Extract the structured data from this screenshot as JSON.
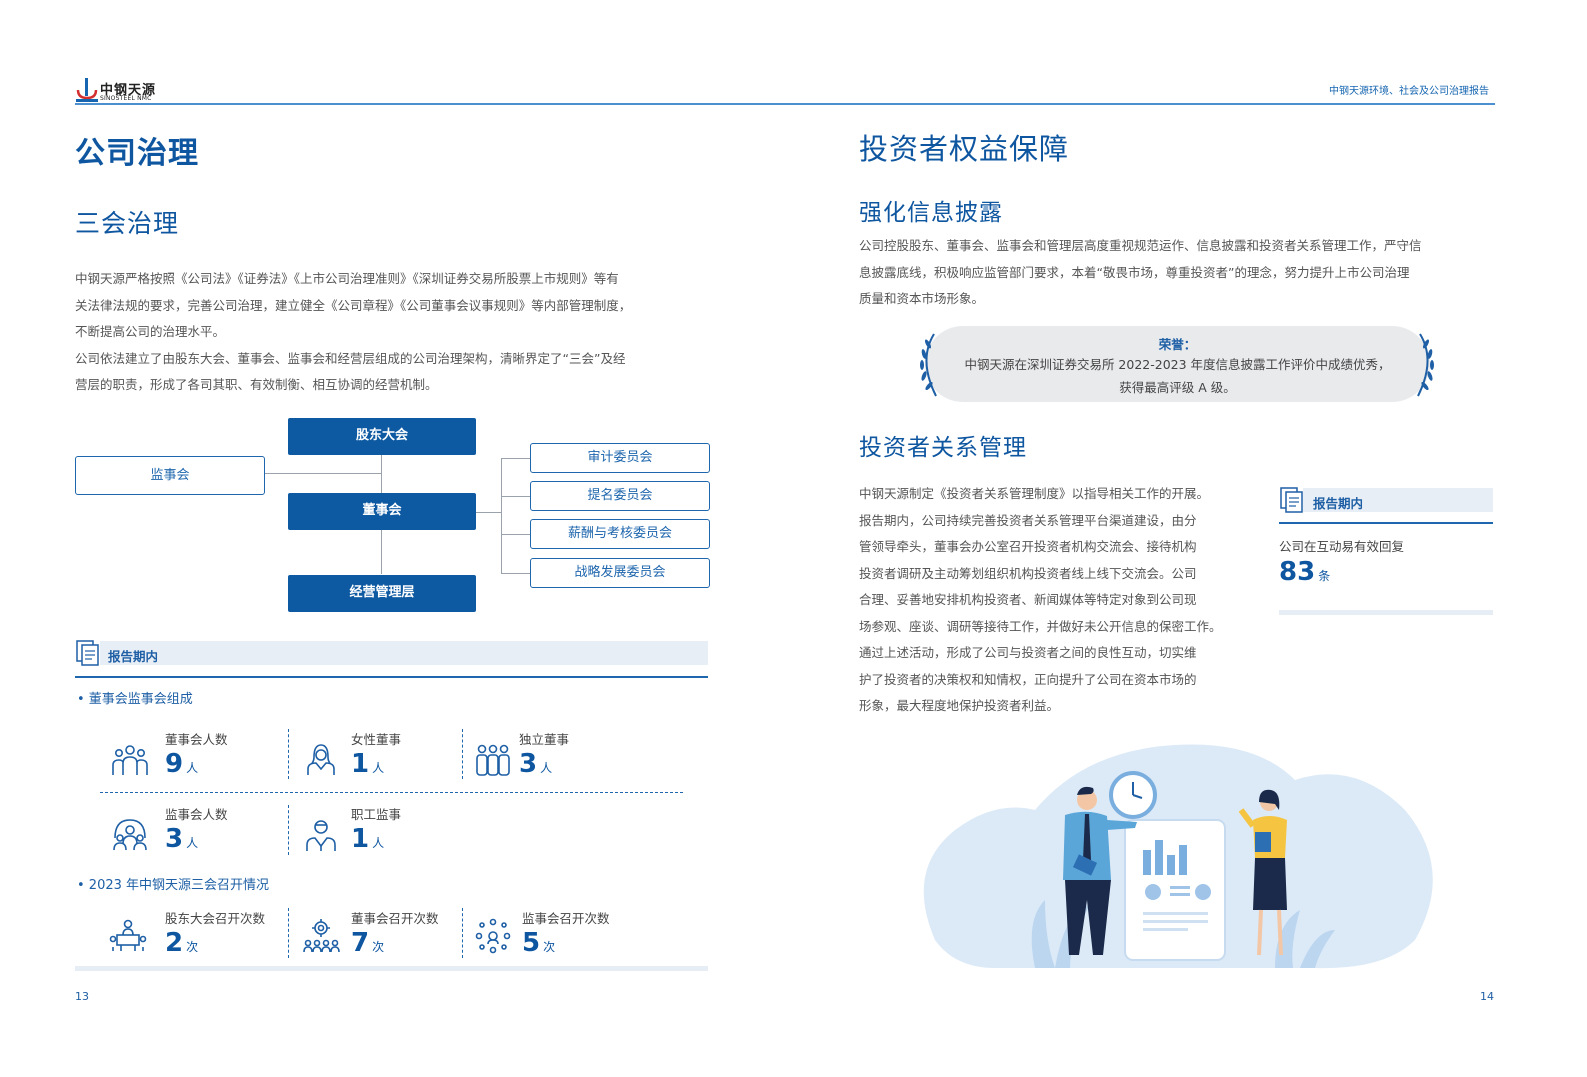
{
  "header": {
    "logo_cn": "中钢天源",
    "logo_en": "SINOSTEEL NMC",
    "report_title": "中钢天源环境、社会及公司治理报告"
  },
  "left": {
    "title": "公司治理",
    "section_title": "三会治理",
    "paragraph_lines": [
      "中钢天源严格按照《公司法》《证券法》《上市公司治理准则》《深圳证券交易所股票上市规则》等有",
      "关法律法规的要求，完善公司治理，建立健全《公司章程》《公司董事会议事规则》等内部管理制度，",
      "不断提高公司的治理水平。",
      "公司依法建立了由股东大会、董事会、监事会和经营层组成的公司治理架构，清晰界定了“三会”及经",
      "营层的职责，形成了各司其职、有效制衡、相互协调的经营机制。"
    ],
    "org_chart": {
      "shareholders": "股东大会",
      "supervisors": "监事会",
      "board": "董事会",
      "management": "经营管理层",
      "committees": [
        "审计委员会",
        "提名委员会",
        "薪酬与考核委员会",
        "战略发展委员会"
      ]
    },
    "info_header": "报告期内",
    "composition_title": "• 董事会监事会组成",
    "composition_stats": [
      {
        "label": "董事会人数",
        "value": "9",
        "unit": "人",
        "icon": "group-people-icon"
      },
      {
        "label": "女性董事",
        "value": "1",
        "unit": "人",
        "icon": "female-person-icon"
      },
      {
        "label": "独立董事",
        "value": "3",
        "unit": "人",
        "icon": "three-people-icon"
      },
      {
        "label": "监事会人数",
        "value": "3",
        "unit": "人",
        "icon": "team-circle-icon"
      },
      {
        "label": "职工监事",
        "value": "1",
        "unit": "人",
        "icon": "worker-person-icon"
      }
    ],
    "meetings_title": "• 2023 年中钢天源三会召开情况",
    "meeting_stats": [
      {
        "label": "股东大会召开次数",
        "value": "2",
        "unit": "次",
        "icon": "meeting-table-icon"
      },
      {
        "label": "董事会召开次数",
        "value": "7",
        "unit": "次",
        "icon": "board-gear-icon"
      },
      {
        "label": "监事会召开次数",
        "value": "5",
        "unit": "次",
        "icon": "supervisor-network-icon"
      }
    ],
    "page_number": "13"
  },
  "right": {
    "title": "投资者权益保障",
    "disclosure_title": "强化信息披露",
    "disclosure_lines": [
      "公司控股股东、董事会、监事会和管理层高度重视规范运作、信息披露和投资者关系管理工作，严守信",
      "息披露底线，积极响应监管部门要求，本着“敬畏市场，尊重投资者”的理念，努力提升上市公司治理",
      "质量和资本市场形象。"
    ],
    "honor": {
      "title": "荣誉：",
      "line1": "中钢天源在深圳证券交易所 2022-2023 年度信息披露工作评价中成绩优秀，",
      "line2": "获得最高评级 A 级。"
    },
    "ir_title": "投资者关系管理",
    "ir_lines": [
      "中钢天源制定《投资者关系管理制度》以指导相关工作的开展。",
      "报告期内，公司持续完善投资者关系管理平台渠道建设，由分",
      "管领导牵头，董事会办公室召开投资者机构交流会、接待机构",
      "投资者调研及主动筹划组织机构投资者线上线下交流会。公司",
      "合理、妥善地安排机构投资者、新闻媒体等特定对象到公司现",
      "场参观、座谈、调研等接待工作，并做好未公开信息的保密工作。",
      "通过上述活动，形成了公司与投资者之间的良性互动，切实维",
      "护了投资者的决策权和知情权，正向提升了公司在资本市场的",
      "形象，最大程度地保护投资者利益。"
    ],
    "info_header": "报告期内",
    "reply_label": "公司在互动易有效回复",
    "reply_value": "83",
    "reply_unit": "条",
    "page_number": "14"
  },
  "colors": {
    "primary": "#0e56a0",
    "accent": "#1e66ad",
    "light_bg": "#e8eef5"
  }
}
